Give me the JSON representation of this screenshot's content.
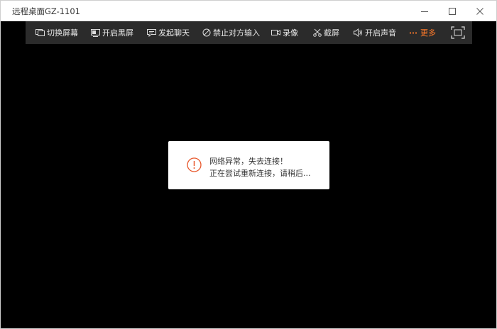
{
  "window": {
    "title": "远程桌面GZ-1101"
  },
  "toolbar": {
    "items": [
      {
        "label": "切换屏幕",
        "icon": "monitor-switch-icon"
      },
      {
        "label": "开启黑屏",
        "icon": "black-screen-icon"
      },
      {
        "label": "发起聊天",
        "icon": "chat-icon"
      },
      {
        "label": "禁止对方输入",
        "icon": "forbid-input-icon"
      },
      {
        "label": "录像",
        "icon": "video-camera-icon"
      },
      {
        "label": "截屏",
        "icon": "scissors-icon"
      },
      {
        "label": "开启声音",
        "icon": "speaker-icon"
      },
      {
        "label": "更多",
        "icon": "more-dots-icon"
      }
    ],
    "fullscreen_icon": "fullscreen-icon"
  },
  "dialog": {
    "icon": "warning-circle-icon",
    "line1": "网络异常，失去连接！",
    "line2": "正在尝试重新连接，请稍后..."
  },
  "colors": {
    "accent": "#ff7a2a",
    "warning": "#e8562a",
    "toolbar_bg": "#2b2b2b",
    "screen_bg": "#000000"
  }
}
